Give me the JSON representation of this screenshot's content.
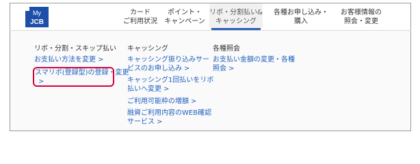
{
  "logo": {
    "top_text": "My",
    "bottom_text": "JCB"
  },
  "nav": [
    {
      "line1": "カード",
      "line2": "ご利用状況"
    },
    {
      "line1": "ポイント・",
      "line2": "キャンペーン"
    },
    {
      "line1": "リボ・分割払い&",
      "line2": "キャッシング"
    },
    {
      "line1": "各種お申し込み・",
      "line2": "購入"
    },
    {
      "line1": "お客様情報の",
      "line2": "照会・変更"
    }
  ],
  "menu": {
    "col1": {
      "title": "リボ・分割・スキップ払い",
      "links": [
        {
          "text": "お支払い方法を変更"
        },
        {
          "line1": "スマリボ(登録型)の登録・変更",
          "line2": ""
        }
      ]
    },
    "col2": {
      "title": "キャッシング",
      "links": [
        {
          "line1": "キャッシング振り込みサー",
          "line2": "ビスのお申し込み"
        },
        {
          "line1": "キャッシング1回払いをリボ",
          "line2": "払いへ変更"
        },
        {
          "text": "ご利用可能枠の増額"
        },
        {
          "line1": "融資ご利用内容のWEB確認",
          "line2": "サービス"
        }
      ]
    },
    "col3": {
      "title": "各種照会",
      "links": [
        {
          "line1": "お支払い金額の変更・各種",
          "line2": "照会"
        }
      ]
    }
  },
  "chevron": ">"
}
